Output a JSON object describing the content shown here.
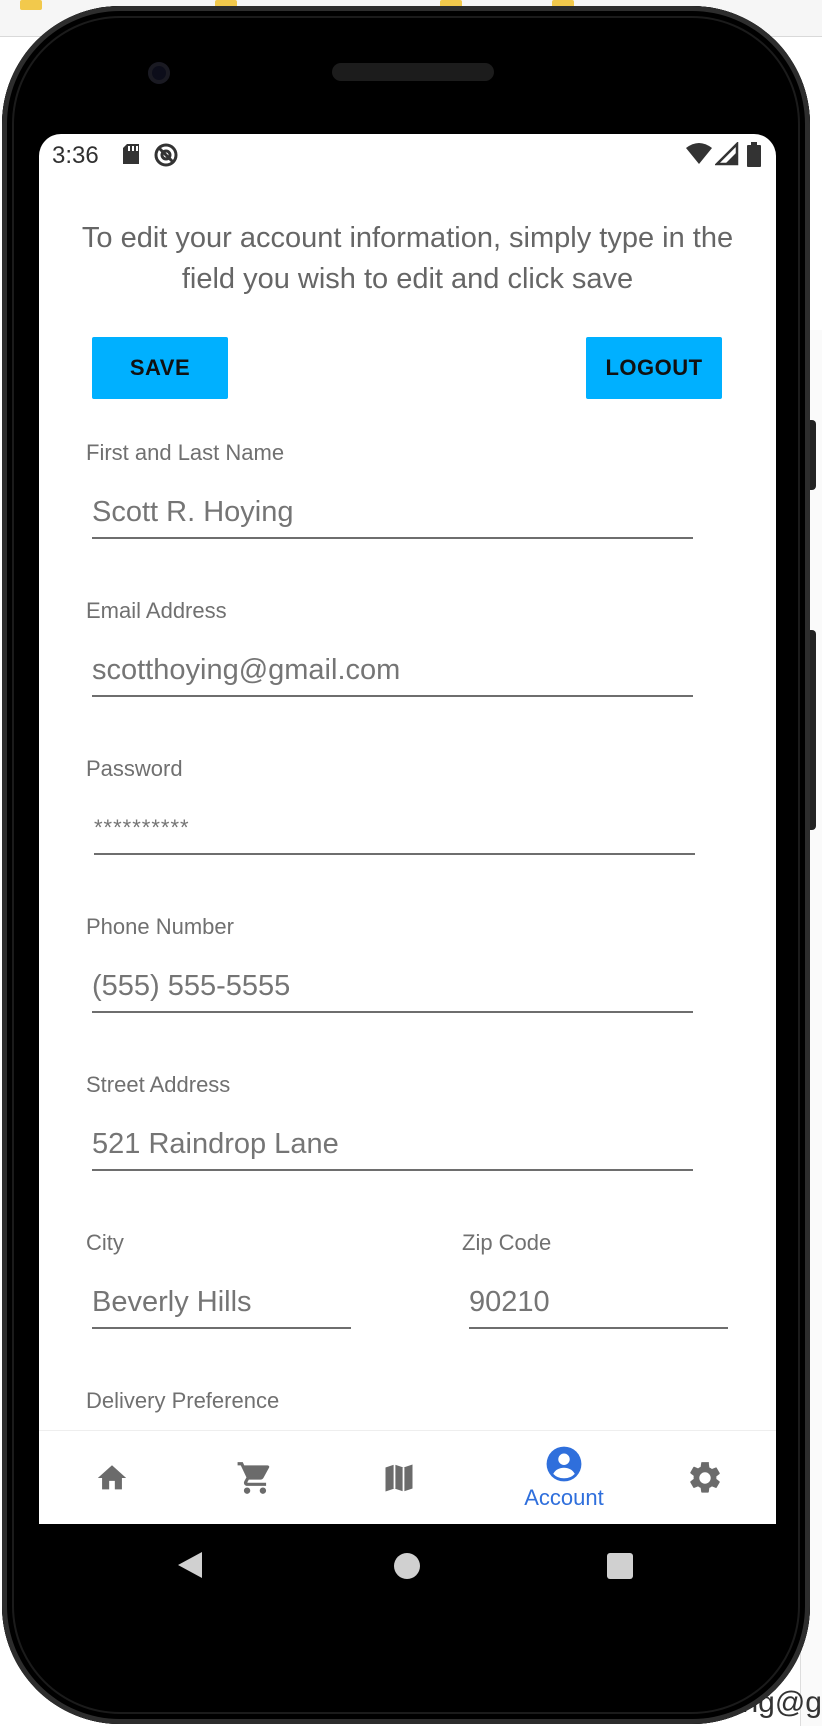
{
  "status_bar": {
    "time": "3:36",
    "left_icons": [
      "sd-card-icon",
      "no-disturb-icon"
    ],
    "right_icons": [
      "wifi-icon",
      "cellular-icon",
      "battery-icon"
    ]
  },
  "page": {
    "instructions": "To edit your account information, simply type in the field you wish to edit and click save"
  },
  "actions": {
    "save_label": "SAVE",
    "logout_label": "LOGOUT",
    "button_color": "#00b0ff"
  },
  "form": {
    "name": {
      "label": "First and Last Name",
      "placeholder": "Scott R. Hoying"
    },
    "email": {
      "label": "Email Address",
      "placeholder": "scotthoying@gmail.com"
    },
    "password": {
      "label": "Password",
      "placeholder": "**********"
    },
    "phone": {
      "label": "Phone Number",
      "placeholder": "(555) 555-5555"
    },
    "street": {
      "label": "Street Address",
      "placeholder": "521 Raindrop Lane"
    },
    "city": {
      "label": "City",
      "placeholder": "Beverly Hills"
    },
    "zip": {
      "label": "Zip Code",
      "placeholder": "90210"
    },
    "delivery": {
      "label": "Delivery Preference"
    }
  },
  "bottom_nav": {
    "items": [
      {
        "icon": "home-icon"
      },
      {
        "icon": "cart-icon"
      },
      {
        "icon": "map-icon"
      },
      {
        "icon": "account-icon",
        "label": "Account",
        "active": true
      },
      {
        "icon": "gear-icon"
      }
    ],
    "active_color": "#2f6fdc",
    "inactive_color": "#6b6b6b"
  },
  "background": {
    "bottom_fragment": "ng@g"
  }
}
